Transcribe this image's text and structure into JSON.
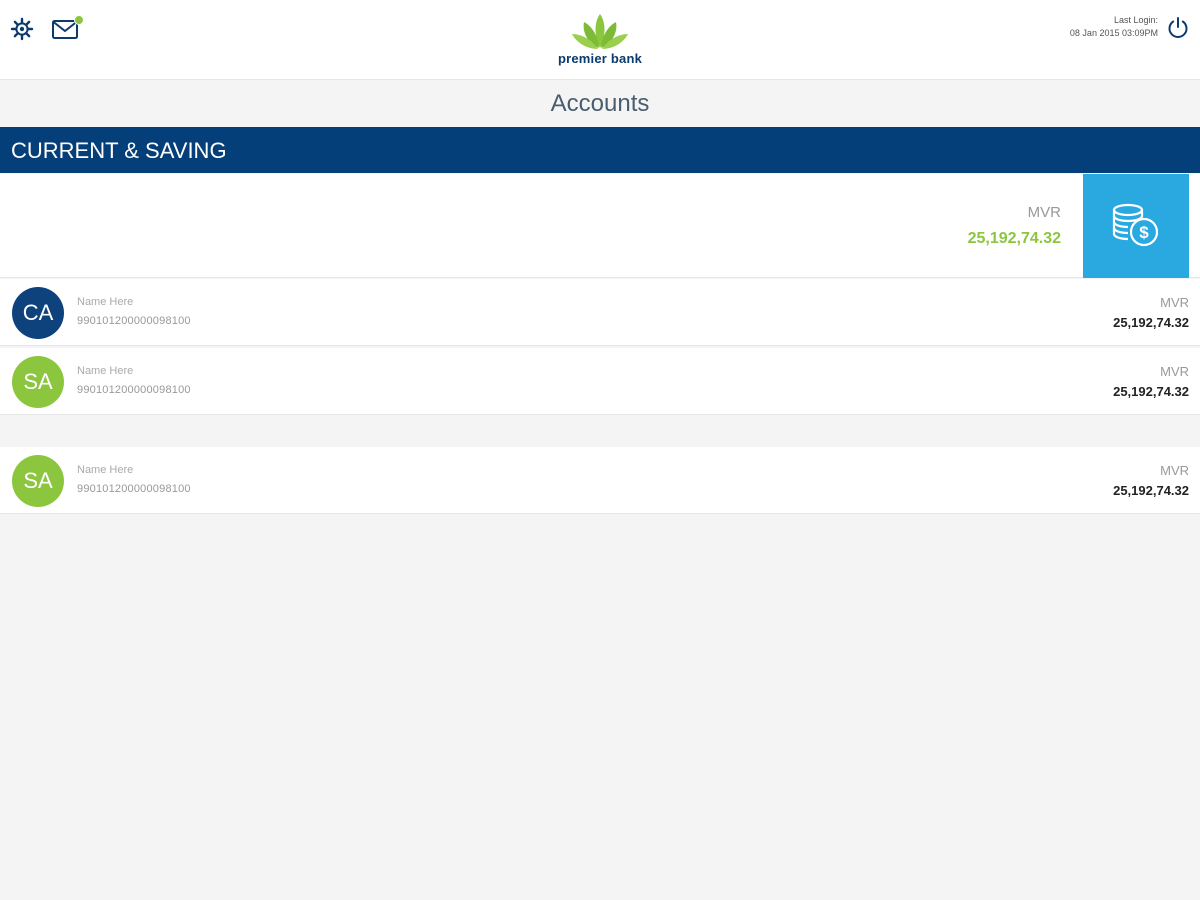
{
  "header": {
    "logo_text": "premier bank",
    "last_login_label": "Last Login:",
    "last_login_value": "08 Jan 2015  03:09PM"
  },
  "page": {
    "title": "Accounts"
  },
  "section": {
    "title": "CURRENT & SAVING",
    "summary": {
      "currency": "MVR",
      "amount": "25,192,74.32"
    }
  },
  "accounts": [
    {
      "initials": "CA",
      "name": "Name Here",
      "number": "990101200000098100",
      "currency": "MVR",
      "balance": "25,192,74.32"
    },
    {
      "initials": "SA",
      "name": "Name Here",
      "number": "990101200000098100",
      "currency": "MVR",
      "balance": "25,192,74.32"
    },
    {
      "initials": "SA",
      "name": "Name Here",
      "number": "990101200000098100",
      "currency": "MVR",
      "balance": "25,192,74.32"
    }
  ],
  "colors": {
    "primary_navy": "#053f7a",
    "accent_green": "#8cc63f",
    "accent_blue": "#2aa8e0",
    "background": "#f4f4f4"
  },
  "icons": {
    "settings": "gear-icon",
    "mail": "mail-icon",
    "power": "power-icon",
    "summary": "coins-dollar-icon",
    "logo": "lotus-logo-icon"
  }
}
